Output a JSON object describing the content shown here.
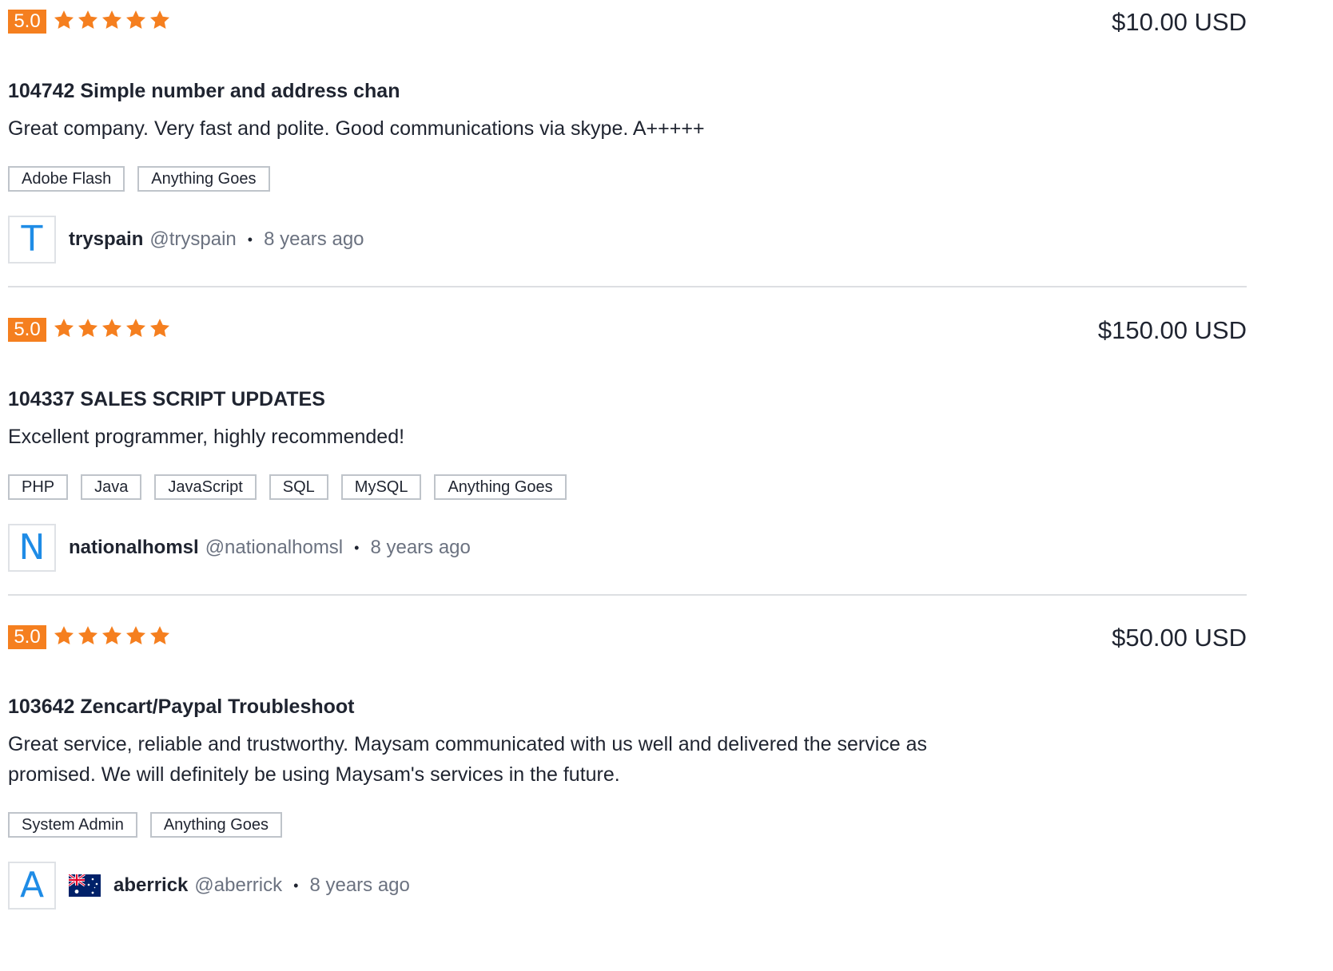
{
  "colors": {
    "accent_orange": "#f57f1f",
    "avatar_letter": "#1f8ce6",
    "text": "#1f2430",
    "muted": "#6b7280",
    "border": "#bfc4ca"
  },
  "reviews": [
    {
      "score": "5.0",
      "stars": 5,
      "price": "$10.00 USD",
      "title": "104742 Simple number and address chan",
      "comment": "Great company. Very fast and polite. Good communications via skype. A+++++",
      "tags": [
        "Adobe Flash",
        "Anything Goes"
      ],
      "avatar_letter": "T",
      "username": "tryspain",
      "handle": "@tryspain",
      "separator": "•",
      "time": "8 years ago"
    },
    {
      "score": "5.0",
      "stars": 5,
      "price": "$150.00 USD",
      "title": "104337 SALES SCRIPT UPDATES",
      "comment": "Excellent programmer, highly recommended!",
      "tags": [
        "PHP",
        "Java",
        "JavaScript",
        "SQL",
        "MySQL",
        "Anything Goes"
      ],
      "avatar_letter": "N",
      "username": "nationalhomsl",
      "handle": "@nationalhomsl",
      "separator": "•",
      "time": "8 years ago"
    },
    {
      "score": "5.0",
      "stars": 5,
      "price": "$50.00 USD",
      "title": "103642 Zencart/Paypal Troubleshoot",
      "comment": "Great service, reliable and trustworthy. Maysam communicated with us well and delivered the service as promised. We will definitely be using Maysam's services in the future.",
      "tags": [
        "System Admin",
        "Anything Goes"
      ],
      "avatar_letter": "A",
      "flag_icon": "australia-flag-icon",
      "username": "aberrick",
      "handle": "@aberrick",
      "separator": "•",
      "time": "8 years ago"
    }
  ]
}
